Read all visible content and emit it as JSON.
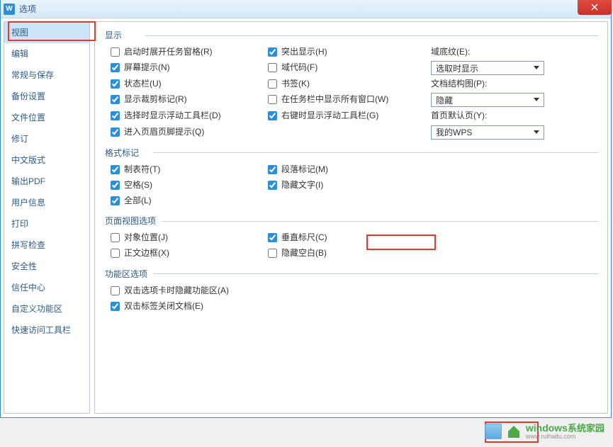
{
  "window": {
    "title": "选项"
  },
  "sidebar": {
    "items": [
      {
        "label": "视图",
        "active": true
      },
      {
        "label": "编辑"
      },
      {
        "label": "常规与保存"
      },
      {
        "label": "备份设置"
      },
      {
        "label": "文件位置"
      },
      {
        "label": "修订"
      },
      {
        "label": "中文版式"
      },
      {
        "label": "输出PDF"
      },
      {
        "label": "用户信息"
      },
      {
        "label": "打印"
      },
      {
        "label": "拼写检查"
      },
      {
        "label": "安全性"
      },
      {
        "label": "信任中心"
      },
      {
        "label": "自定义功能区"
      },
      {
        "label": "快速访问工具栏"
      }
    ]
  },
  "groups": {
    "display": {
      "title": "显示",
      "startup_taskpane": "启动时展开任务窗格(R)",
      "highlight": "突出显示(H)",
      "screen_tips": "屏幕提示(N)",
      "field_codes": "域代码(F)",
      "status_bar": "状态栏(U)",
      "bookmarks": "书签(K)",
      "crop_marks": "显示裁剪标记(R)",
      "all_windows_taskbar": "在任务栏中显示所有窗口(W)",
      "float_toolbar_select": "选择时显示浮动工具栏(D)",
      "float_toolbar_rightclick": "右键时显示浮动工具栏(G)",
      "header_footer_guide": "进入页眉页脚提示(Q)",
      "field_shading_label": "域底纹(E):",
      "field_shading_value": "选取时显示",
      "doc_map_label": "文档结构图(P):",
      "doc_map_value": "隐藏",
      "homepage_label": "首页默认页(Y):",
      "homepage_value": "我的WPS"
    },
    "format_marks": {
      "title": "格式标记",
      "tabs": "制表符(T)",
      "spaces": "空格(S)",
      "all": "全部(L)",
      "paragraph": "段落标记(M)",
      "hidden_text": "隐藏文字(I)"
    },
    "page_view": {
      "title": "页面视图选项",
      "object_pos": "对象位置(J)",
      "text_boundary": "正文边框(X)",
      "vertical_ruler": "垂直标尺(C)",
      "hide_blank": "隐藏空白(B)"
    },
    "ribbon": {
      "title": "功能区选项",
      "dblclick_tab_hide": "双击选项卡时隐藏功能区(A)",
      "dblclick_label_close": "双击标签关闭文档(E)"
    }
  },
  "watermark": {
    "brand": "windows",
    "brand_cn": "系统家园",
    "url": "www.ruihaitu.com"
  }
}
